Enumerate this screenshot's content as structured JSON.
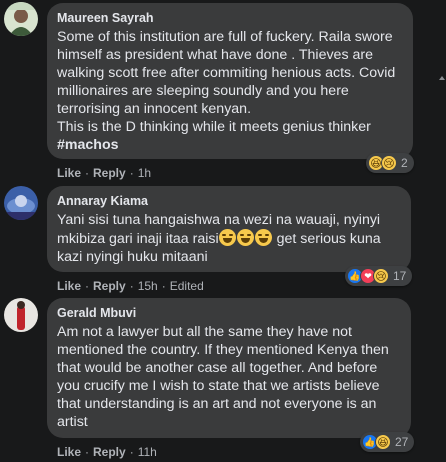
{
  "comments": [
    {
      "author": "Maureen Sayrah",
      "text": "Some of this institution are full of fuckery. Raila swore himself as president what have done . Thieves are walking scott free after commiting henious acts. Covid millionaires are sleeping soundly and you here terrorising an innocent kenyan.\nThis is the D thinking while it meets genius thinker",
      "hashtag": "#machos",
      "reactions": [
        "haha-icon",
        "sad-icon"
      ],
      "reaction_count": "2",
      "like": "Like",
      "reply": "Reply",
      "time": "1h",
      "edited": ""
    },
    {
      "author": "Annaray Kiama",
      "text_part1": "Yani sisi tuna hangaishwa na wezi na wauaji, nyinyi mkibiza gari inaji itaa raisi",
      "text_part2": " get serious kuna kazi nyingi huku mitaani",
      "reactions": [
        "like-icon",
        "love-icon",
        "sad-icon"
      ],
      "reaction_count": "17",
      "like": "Like",
      "reply": "Reply",
      "time": "15h",
      "edited": "Edited"
    },
    {
      "author": "Gerald Mbuvi",
      "text": "Am not a lawyer but all the same they have not mentioned the country. If they mentioned Kenya then that would be another case all together. And before you crucify me I wish to state that we artists believe that understanding is an art and not everyone is an artist",
      "reactions": [
        "like-icon",
        "haha-icon"
      ],
      "reaction_count": "27",
      "like": "Like",
      "reply": "Reply",
      "time": "11h",
      "edited": ""
    }
  ]
}
